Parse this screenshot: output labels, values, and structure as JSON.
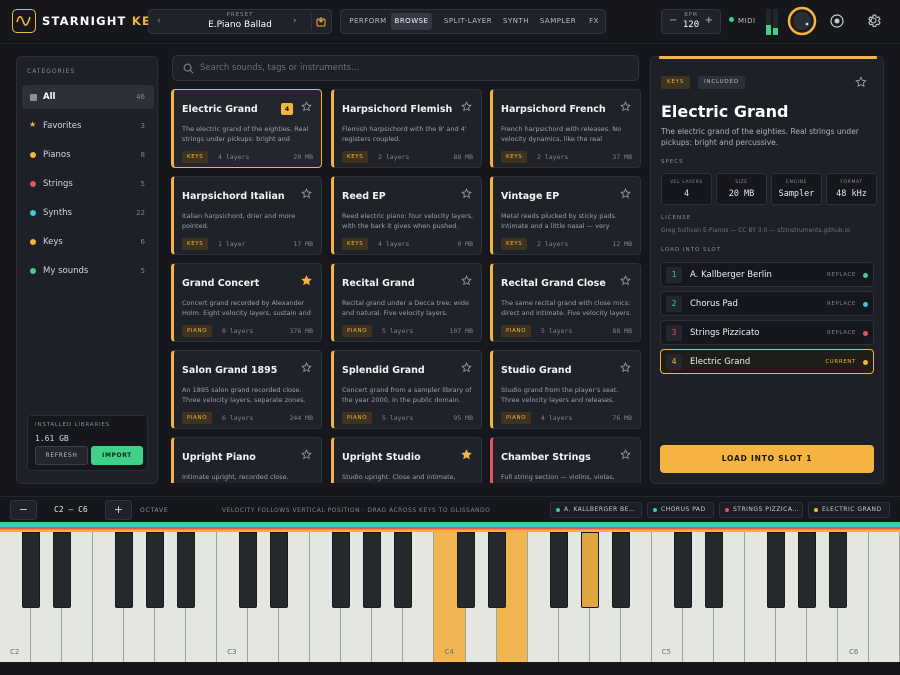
{
  "brand": {
    "name": "STARNIGHT",
    "accent": "KEYS"
  },
  "preset": {
    "label": "PRESET",
    "value": "E.Piano Ballad"
  },
  "modes": [
    "PERFORM",
    "BROWSE",
    "SPLIT-LAYER",
    "SYNTH",
    "SAMPLER",
    "FX"
  ],
  "active_mode": "BROWSE",
  "bpm": {
    "label": "BPM",
    "value": "120",
    "minus": "−",
    "plus": "+"
  },
  "midi": {
    "label": "MIDI"
  },
  "sidebar": {
    "caption": "CATEGORIES",
    "items": [
      {
        "label": "All",
        "count": "46",
        "color": "#8a8f99",
        "icon": "square-icon"
      },
      {
        "label": "Favorites",
        "count": "3",
        "color": "#f5b340",
        "icon": "star-icon"
      },
      {
        "label": "Pianos",
        "count": "8",
        "color": "#f5b340",
        "icon": "dot-icon"
      },
      {
        "label": "Strings",
        "count": "5",
        "color": "#e8545e",
        "icon": "dot-icon"
      },
      {
        "label": "Synths",
        "count": "22",
        "color": "#3fc6d8",
        "icon": "dot-icon"
      },
      {
        "label": "Keys",
        "count": "6",
        "color": "#f5b340",
        "icon": "dot-icon"
      },
      {
        "label": "My sounds",
        "count": "5",
        "color": "#3fd08a",
        "icon": "dot-icon"
      }
    ],
    "libraries": {
      "caption": "INSTALLED LIBRARIES",
      "size": "1.61 GB",
      "refresh": "REFRESH",
      "import": "IMPORT"
    }
  },
  "search": {
    "placeholder": "Search sounds, tags or instruments…"
  },
  "cards": [
    {
      "title": "Electric Grand",
      "desc": "The electric grand of the eighties. Real strings under pickups: bright and percussive.",
      "tag": "KEYS",
      "layers": "4 layers",
      "size": "20 MB",
      "fav": false,
      "badge": "4",
      "selected": true
    },
    {
      "title": "Harpsichord Flemish",
      "desc": "Flemish harpsichord with the 8' and 4' registers coupled.",
      "tag": "KEYS",
      "layers": "2 layers",
      "size": "88 MB",
      "fav": false
    },
    {
      "title": "Harpsichord French",
      "desc": "French harpsichord with releases. No velocity dynamics, like the real instrument.",
      "tag": "KEYS",
      "layers": "2 layers",
      "size": "37 MB",
      "fav": false
    },
    {
      "title": "Harpsichord Italian",
      "desc": "Italian harpsichord, drier and more pointed.",
      "tag": "KEYS",
      "layers": "1 layer",
      "size": "17 MB",
      "fav": false
    },
    {
      "title": "Reed EP",
      "desc": "Reed electric piano: four velocity layers, with the bark it gives when pushed.",
      "tag": "KEYS",
      "layers": "4 layers",
      "size": "9 MB",
      "fav": false
    },
    {
      "title": "Vintage EP",
      "desc": "Metal reeds plucked by sticky pads. Intimate and a little nasal — very recognisable.",
      "tag": "KEYS",
      "layers": "2 layers",
      "size": "12 MB",
      "fav": false
    },
    {
      "title": "Grand Concert",
      "desc": "Concert grand recorded by Alexander Holm. Eight velocity layers, sustain and release.",
      "tag": "PIANO",
      "layers": "8 layers",
      "size": "376 MB",
      "fav": true
    },
    {
      "title": "Recital Grand",
      "desc": "Recital grand under a Decca tree: wide and natural. Five velocity layers.",
      "tag": "PIANO",
      "layers": "5 layers",
      "size": "107 MB",
      "fav": false
    },
    {
      "title": "Recital Grand Close",
      "desc": "The same recital grand with close mics: direct and intimate. Five velocity layers.",
      "tag": "PIANO",
      "layers": "5 layers",
      "size": "88 MB",
      "fav": false
    },
    {
      "title": "Salon Grand 1895",
      "desc": "An 1895 salon grand recorded close. Three velocity layers, separate zones.",
      "tag": "PIANO",
      "layers": "6 layers",
      "size": "244 MB",
      "fav": false
    },
    {
      "title": "Splendid Grand",
      "desc": "Concert grand from a sampler library of the year 2000, in the public domain.",
      "tag": "PIANO",
      "layers": "5 layers",
      "size": "95 MB",
      "fav": false
    },
    {
      "title": "Studio Grand",
      "desc": "Studio grand from the player's seat. Three velocity layers and releases.",
      "tag": "PIANO",
      "layers": "4 layers",
      "size": "76 MB",
      "fav": false
    },
    {
      "title": "Upright Piano",
      "desc": "Intimate upright, recorded close.",
      "tag": "PIANO",
      "layers": "",
      "size": "",
      "fav": false
    },
    {
      "title": "Upright Studio",
      "desc": "Studio upright. Close and intimate, warm.",
      "tag": "PIANO",
      "layers": "",
      "size": "",
      "fav": true
    },
    {
      "title": "Chamber Strings",
      "desc": "Full string section — violins, violas, cellos.",
      "tag": "STRINGS",
      "layers": "",
      "size": "",
      "fav": false,
      "strings": true
    }
  ],
  "detail": {
    "tags": [
      "KEYS",
      "INCLUDED"
    ],
    "title": "Electric Grand",
    "desc": "The electric grand of the eighties. Real strings under pickups: bright and percussive.",
    "specs_caption": "SPECS",
    "specs": [
      {
        "label": "VEL LAYERS",
        "value": "4"
      },
      {
        "label": "SIZE",
        "value": "20 MB"
      },
      {
        "label": "ENGINE",
        "value": "Sampler"
      },
      {
        "label": "FORMAT",
        "value": "48 kHz"
      }
    ],
    "license_caption": "LICENSE",
    "license": "Greg Sullivan E-Pianos — CC BY 3.0 — sfzinstruments.github.io",
    "slots_caption": "LOAD INTO SLOT",
    "slots": [
      {
        "num": "1",
        "name": "A. Kallberger Berlin",
        "action": "REPLACE",
        "color": "#3fd08a"
      },
      {
        "num": "2",
        "name": "Chorus Pad",
        "action": "REPLACE",
        "color": "#3fc6d8"
      },
      {
        "num": "3",
        "name": "Strings Pizzicato",
        "action": "REPLACE",
        "color": "#e8545e"
      },
      {
        "num": "4",
        "name": "Electric Grand",
        "action": "CURRENT",
        "color": "#f5b340"
      }
    ],
    "load_button": "LOAD INTO SLOT 1"
  },
  "keyboard": {
    "minus": "−",
    "plus": "+",
    "range": "C2 — C6",
    "octave_label": "OCTAVE",
    "hint": "VELOCITY FOLLOWS VERTICAL POSITION · DRAG ACROSS KEYS TO GLISSANDO",
    "chips": [
      {
        "label": "A. KALLBERGER BE…",
        "color": "#3fd08a"
      },
      {
        "label": "CHORUS PAD",
        "color": "#3fc6d8"
      },
      {
        "label": "STRINGS PIZZICA…",
        "color": "#e8545e"
      },
      {
        "label": "ELECTRIC GRAND",
        "color": "#f5b340"
      }
    ],
    "octave_labels": [
      "C2",
      "C3",
      "C4",
      "C5",
      "C6"
    ]
  },
  "colors": {
    "accent": "#f5b340",
    "green": "#3fd08a",
    "cyan": "#3fc6d8",
    "red": "#e8545e"
  }
}
